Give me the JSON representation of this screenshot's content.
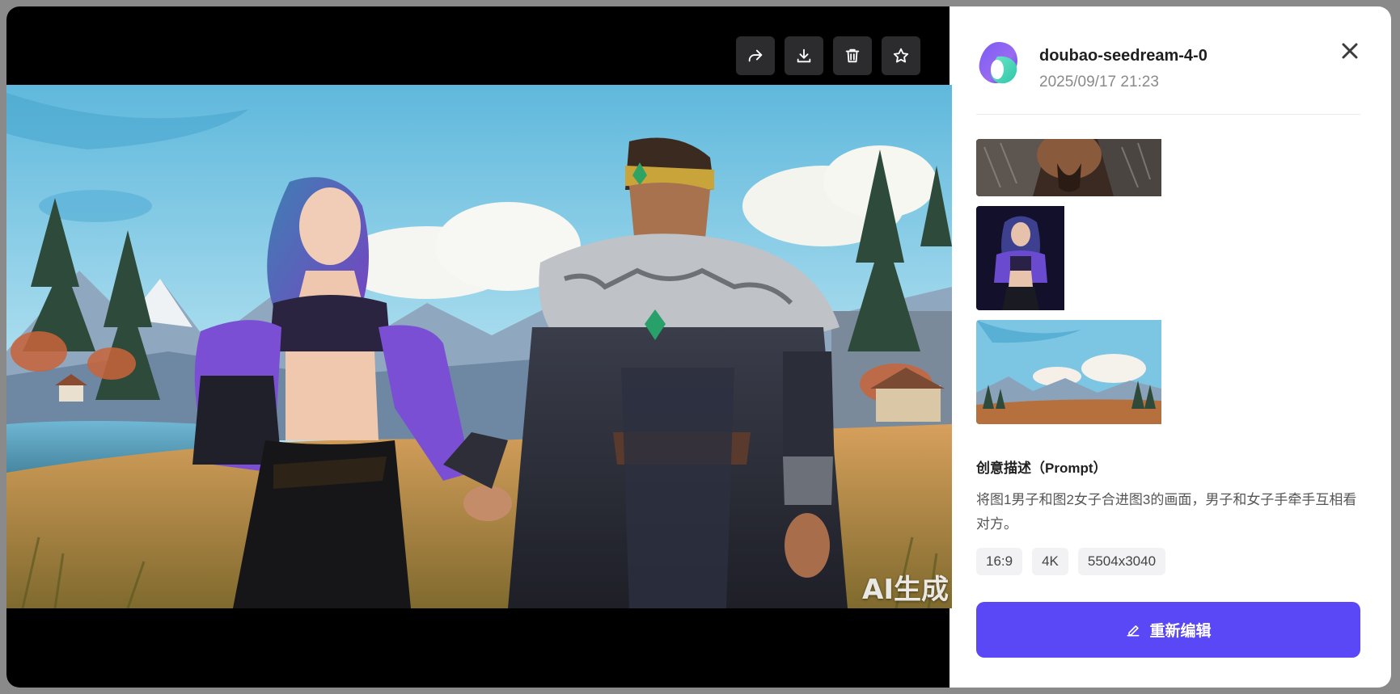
{
  "modal": {
    "model_name": "doubao-seedream-4-0",
    "timestamp": "2025/09/17 21:23",
    "prompt_label": "创意描述（Prompt）",
    "prompt_text": "将图1男子和图2女子合进图3的画面，男子和女子手牵手互相看对方。",
    "tags": [
      "16:9",
      "4K",
      "5504x3040"
    ],
    "edit_button_label": "重新编辑",
    "watermark": "AI生成"
  },
  "toolbar": {
    "buttons": [
      "share-icon",
      "download-icon",
      "trash-icon",
      "star-icon"
    ]
  },
  "reference_images": [
    "reference-image-man",
    "reference-image-woman",
    "reference-image-landscape"
  ],
  "colors": {
    "accent": "#5a48f6",
    "viewer_bg": "#000000",
    "tool_button_bg": "#2c2c2e",
    "tag_bg": "#f2f2f4"
  }
}
